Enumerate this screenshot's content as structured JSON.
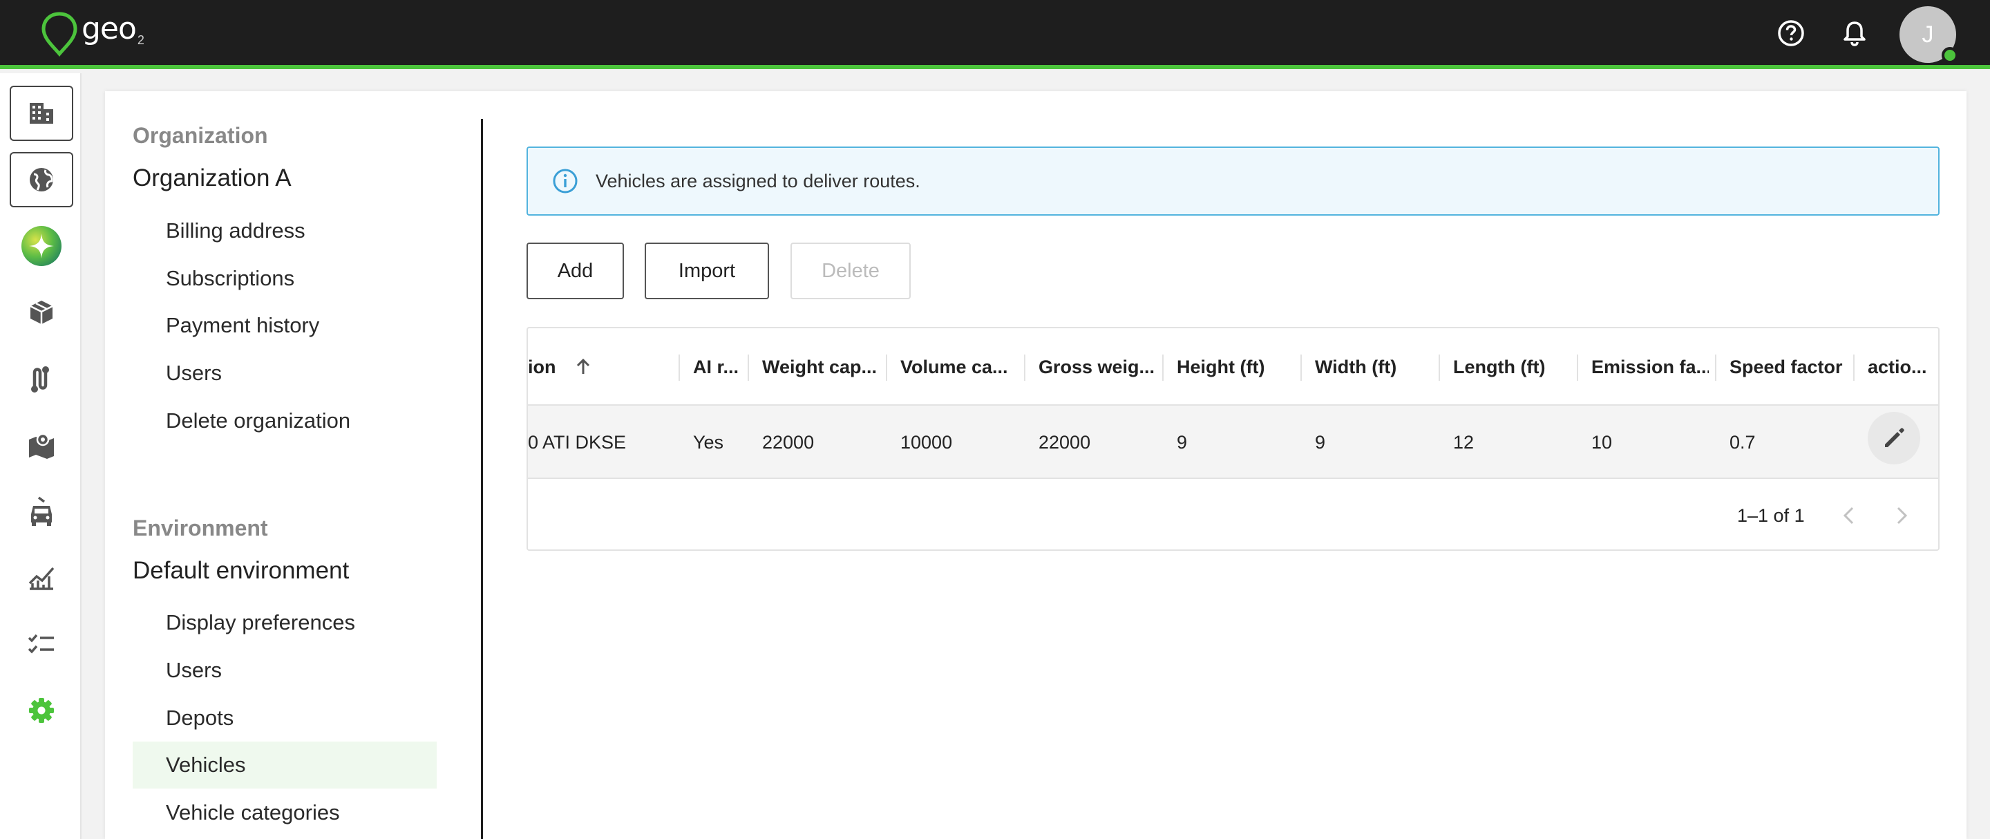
{
  "app": {
    "logo_text": "geo",
    "logo_sub": "2",
    "avatar_initial": "J"
  },
  "colors": {
    "brand_green": "#4cc43c",
    "topbar": "#1e1e1e",
    "info_border": "#53b4de",
    "info_bg": "#eef8fd",
    "active_bg": "#eff9ee"
  },
  "rail": {
    "items": [
      {
        "icon": "building-icon"
      },
      {
        "icon": "globe-icon"
      },
      {
        "icon": "ai-sparkle-icon"
      },
      {
        "icon": "package-icon"
      },
      {
        "icon": "route-icon"
      },
      {
        "icon": "map-icon"
      },
      {
        "icon": "vehicle-icon"
      },
      {
        "icon": "analytics-icon"
      },
      {
        "icon": "checklist-icon"
      },
      {
        "icon": "settings-icon"
      }
    ]
  },
  "sidebar": {
    "org_heading": "Organization",
    "org_name": "Organization A",
    "org_items": [
      "Billing address",
      "Subscriptions",
      "Payment history",
      "Users",
      "Delete organization"
    ],
    "env_heading": "Environment",
    "env_name": "Default environment",
    "env_items": [
      "Display preferences",
      "Users",
      "Depots",
      "Vehicles",
      "Vehicle categories"
    ],
    "active_item": "Vehicles"
  },
  "alert": {
    "text": "Vehicles are assigned to deliver routes."
  },
  "toolbar": {
    "add_label": "Add",
    "import_label": "Import",
    "delete_label": "Delete"
  },
  "table": {
    "columns": [
      "ion",
      "AI r...",
      "Weight cap...",
      "Volume ca...",
      "Gross weig...",
      "Height (ft)",
      "Width (ft)",
      "Length (ft)",
      "Emission fa...",
      "Speed factor",
      "actio..."
    ],
    "rows": [
      [
        "0 ATI DKSE",
        "Yes",
        "22000",
        "10000",
        "22000",
        "9",
        "9",
        "12",
        "10",
        "0.7"
      ]
    ],
    "pagination": "1–1 of 1"
  }
}
